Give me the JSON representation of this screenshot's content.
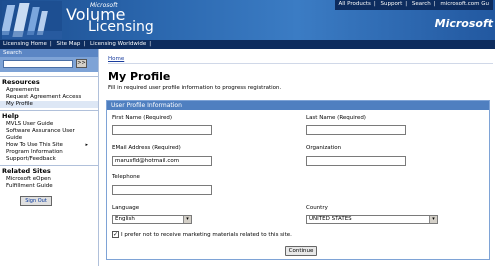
{
  "header": {
    "logo_small": "Microsoft",
    "logo_line1": "Volume",
    "logo_line2": "Licensing",
    "top_links": [
      "All Products",
      "Support",
      "Search",
      "microsoft.com Gu"
    ],
    "brand": "Microsoft"
  },
  "navbar": {
    "items": [
      "Licensing Home",
      "Site Map",
      "Licensing Worldwide"
    ]
  },
  "sidebar": {
    "search_label": "Search",
    "go_label": ">>",
    "sections": [
      {
        "title": "Resources",
        "items": [
          "Agreements",
          "Request Agreement Access",
          "My Profile"
        ]
      },
      {
        "title": "Help",
        "items": [
          "MVLS User Guide",
          "Software Assurance User Guide",
          "How To Use This Site",
          "Program Information",
          "Support/Feedback"
        ]
      },
      {
        "title": "Related Sites",
        "items": [
          "Microsoft eOpen",
          "Fulfillment Guide"
        ]
      }
    ],
    "signout_label": "Sign Out"
  },
  "main": {
    "breadcrumb": "Home",
    "title": "My Profile",
    "description": "Fill in required user profile information to progress registration.",
    "panel_title": "User Profile Information",
    "first_name_label": "First Name (Required)",
    "last_name_label": "Last Name (Required)",
    "email_label": "EMail Address (Required)",
    "email_value": "marusfld@hotmail.com",
    "organization_label": "Organization",
    "telephone_label": "Telephone",
    "language_label": "Language",
    "language_value": "English",
    "country_label": "Country",
    "country_value": "UNITED STATES",
    "marketing_optout": "I prefer not to receive marketing materials related to this site.",
    "marketing_checked": true,
    "continue_label": "Continue"
  }
}
